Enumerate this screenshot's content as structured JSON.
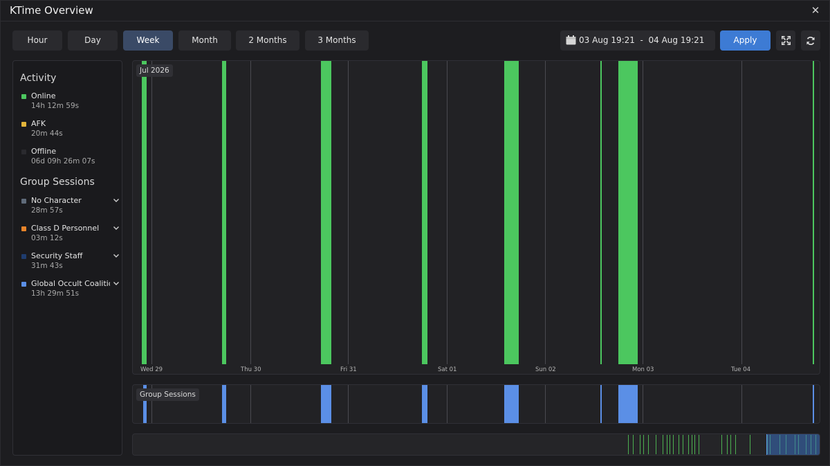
{
  "window": {
    "title": "KTime Overview",
    "close_glyph": "✕"
  },
  "toolbar": {
    "ranges": [
      {
        "label": "Hour",
        "active": false
      },
      {
        "label": "Day",
        "active": false
      },
      {
        "label": "Week",
        "active": true
      },
      {
        "label": "Month",
        "active": false
      },
      {
        "label": "2 Months",
        "active": false
      },
      {
        "label": "3 Months",
        "active": false
      }
    ],
    "date_range": "03 Aug 19:21  -  04 Aug 19:21",
    "apply_label": "Apply",
    "icons": [
      "calendar-icon",
      "fullscreen-icon",
      "refresh-icon"
    ]
  },
  "sidebar": {
    "activity_title": "Activity",
    "activity": [
      {
        "name": "Online",
        "value": "14h 12m 59s",
        "color": "#4cc75f"
      },
      {
        "name": "AFK",
        "value": "20m 44s",
        "color": "#e2b43a"
      },
      {
        "name": "Offline",
        "value": "06d 09h 26m 07s",
        "color": "#2a2a2e"
      }
    ],
    "groups_title": "Group Sessions",
    "groups": [
      {
        "name": "No Character",
        "value": "28m 57s",
        "color": "#5f6b7a"
      },
      {
        "name": "Class D Personnel",
        "value": "03m 12s",
        "color": "#e8842a"
      },
      {
        "name": "Security Staff",
        "value": "31m 43s",
        "color": "#1f3c6e"
      },
      {
        "name": "Global Occult Coalition",
        "value": "13h 29m 51s",
        "color": "#5b8fe6"
      }
    ]
  },
  "timeline": {
    "period_label": "Jul 2026",
    "day_labels": [
      "Wed 29",
      "Thu 30",
      "Fri 31",
      "Sat 01",
      "Sun 02",
      "Mon 03",
      "Tue 04"
    ],
    "online_color": "#4cc75f",
    "group_color": "#5b8fe6"
  },
  "group_sessions_panel": {
    "label": "Group Sessions"
  }
}
